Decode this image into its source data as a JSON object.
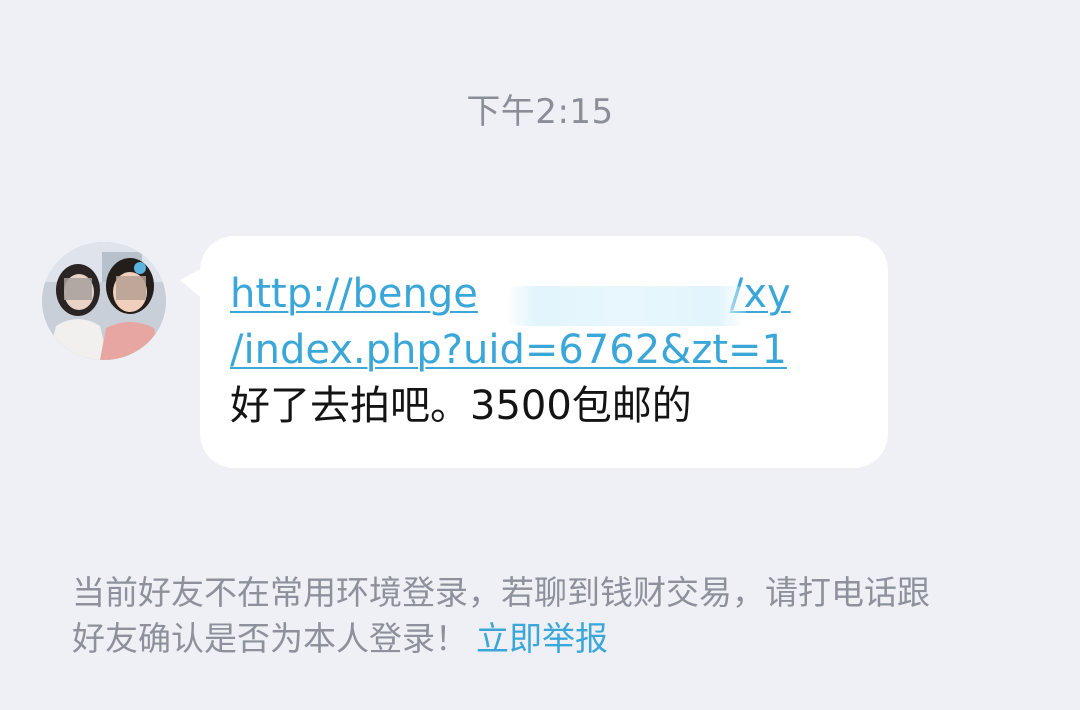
{
  "chat": {
    "timestamp": "下午2:15",
    "message": {
      "link_line1_prefix": "http://benge",
      "link_line1_suffix": "/xy",
      "link_line2": "/index.php?uid=6762&zt=1",
      "text": "好了去拍吧。3500包邮的"
    },
    "security_notice": {
      "line1": "当前好友不在常用环境登录，若聊到钱财交易，请打电话跟",
      "line2": "好友确认是否为本人登录！",
      "report_link": "立即举报"
    }
  },
  "colors": {
    "background": "#eef0f6",
    "bubble": "#ffffff",
    "link": "#3aa7d8",
    "muted_text": "#8e919b"
  }
}
